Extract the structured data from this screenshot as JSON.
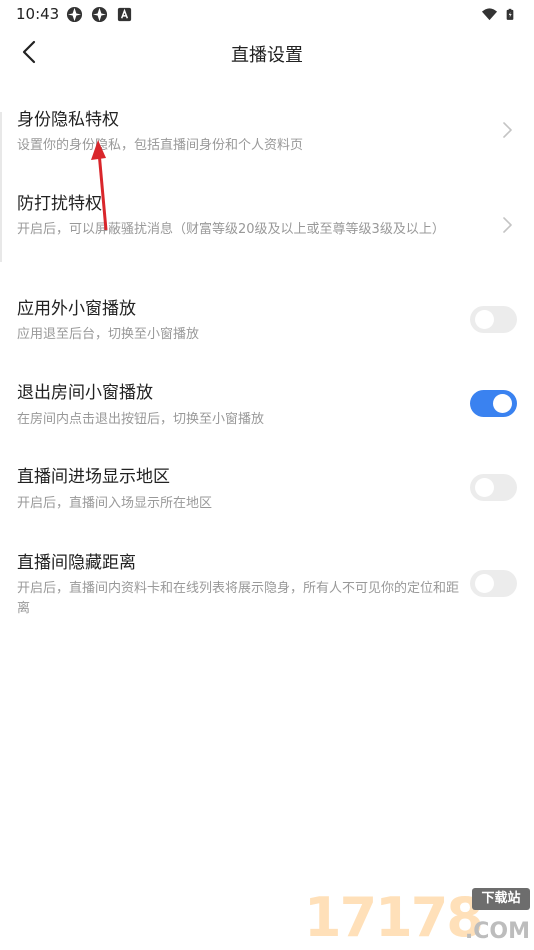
{
  "status_bar": {
    "time": "10:43",
    "left_icons": [
      "app-notification-icon",
      "app-notification-icon",
      "android-icon"
    ],
    "right_icons": [
      "wifi-icon",
      "battery-icon"
    ]
  },
  "nav": {
    "title": "直播设置",
    "back_icon": "chevron-left-icon"
  },
  "settings": [
    {
      "id": "identity-privacy",
      "title": "身份隐私特权",
      "desc": "设置你的身份隐私，包括直播间身份和个人资料页",
      "control": "chevron"
    },
    {
      "id": "anti-harass",
      "title": "防打扰特权",
      "desc": "开启后，可以屏蔽骚扰消息（财富等级20级及以上或至尊等级3级及以上）",
      "control": "chevron"
    },
    {
      "id": "outside-mini-window",
      "title": "应用外小窗播放",
      "desc": "应用退至后台，切换至小窗播放",
      "control": "toggle",
      "enabled": false
    },
    {
      "id": "exit-room-mini-window",
      "title": "退出房间小窗播放",
      "desc": "在房间内点击退出按钮后，切换至小窗播放",
      "control": "toggle",
      "enabled": true
    },
    {
      "id": "show-region",
      "title": "直播间进场显示地区",
      "desc": "开启后，直播间入场显示所在地区",
      "control": "toggle",
      "enabled": false
    },
    {
      "id": "hide-distance",
      "title": "直播间隐藏距离",
      "desc": "开启后，直播间内资料卡和在线列表将展示隐身，所有人不可见你的定位和距离",
      "control": "toggle",
      "enabled": false
    }
  ],
  "colors": {
    "toggle_on": "#3a82f0",
    "toggle_off": "#ececec",
    "annotation_arrow": "#d9262b"
  },
  "watermark": {
    "digits": "17178",
    "badge": "下载站",
    "domain": ".COM"
  }
}
